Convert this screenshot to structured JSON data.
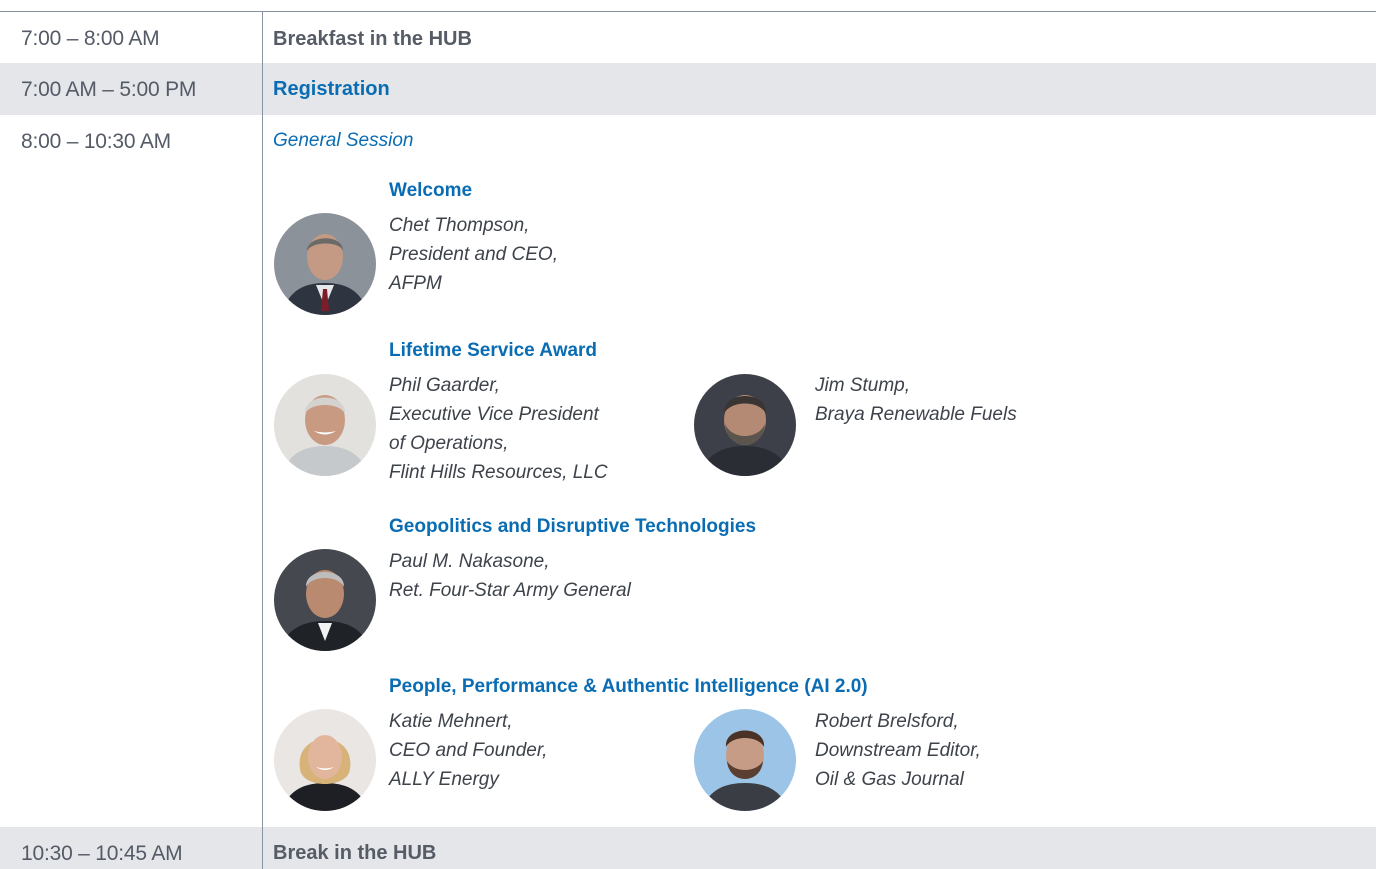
{
  "schedule": [
    {
      "time": "7:00 – 8:00 AM",
      "event": "Breakfast in the HUB"
    },
    {
      "time": "7:00 AM – 5:00 PM",
      "event": "Registration"
    },
    {
      "time": "8:00 – 10:30 AM",
      "event": "General Session"
    },
    {
      "time": "10:30 – 10:45 AM",
      "event": "Break in the HUB"
    }
  ],
  "session": {
    "blocks": [
      {
        "title": "Welcome",
        "speakers": [
          {
            "lines": [
              "Chet Thompson,",
              "President and CEO,",
              "AFPM"
            ]
          }
        ]
      },
      {
        "title": "Lifetime Service Award",
        "speakers": [
          {
            "lines": [
              "Phil Gaarder,",
              "Executive Vice President",
              "of Operations,",
              "Flint Hills Resources, LLC"
            ]
          },
          {
            "lines": [
              "Jim Stump,",
              "Braya Renewable Fuels"
            ]
          }
        ]
      },
      {
        "title": "Geopolitics and Disruptive Technologies",
        "speakers": [
          {
            "lines": [
              "Paul M. Nakasone,",
              "Ret. Four-Star Army General"
            ]
          }
        ]
      },
      {
        "title": "People, Performance & Authentic Intelligence (AI 2.0)",
        "speakers": [
          {
            "lines": [
              "Katie Mehnert,",
              "CEO and Founder,",
              "ALLY Energy"
            ]
          },
          {
            "lines": [
              "Robert Brelsford,",
              "Downstream Editor,",
              "Oil & Gas Journal"
            ]
          }
        ]
      }
    ]
  },
  "colors": {
    "accent": "#0a6db3",
    "row_shade": "#e4e6ea",
    "text_gray": "#565c66",
    "rule": "#8a93a3"
  },
  "icons": [
    "speaker-photo-icon"
  ]
}
